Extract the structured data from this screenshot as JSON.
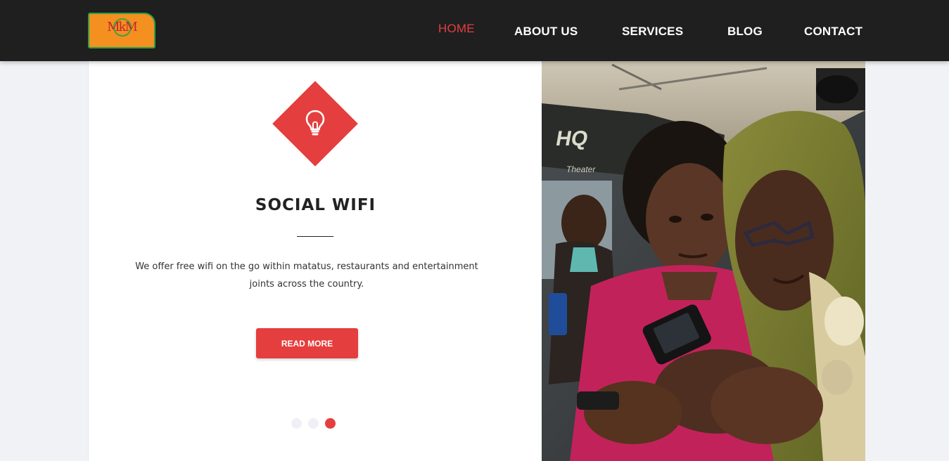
{
  "header": {
    "logo_text": "MkM",
    "nav": [
      {
        "label": "HOME",
        "active": true
      },
      {
        "label": "ABOUT US"
      },
      {
        "label": "SERVICES"
      },
      {
        "label": "BLOG"
      },
      {
        "label": "CONTACT"
      }
    ]
  },
  "slide": {
    "icon": "lightbulb-icon",
    "title": "SOCIAL WIFI",
    "text": "We offer free wifi on the go within matatus, restaurants and entertainment joints across the country.",
    "button_label": "READ MORE",
    "pager": {
      "total": 3,
      "current": 3
    }
  },
  "photo": {
    "subject": "two women looking at a mobile phone inside a bus",
    "signage": "Theater"
  },
  "colors": {
    "header_bg": "#1f1f1f",
    "accent": "#e53e3e",
    "page_bg": "#f1f2f6",
    "logo_bg": "#f39020",
    "logo_border": "#2aa046"
  }
}
